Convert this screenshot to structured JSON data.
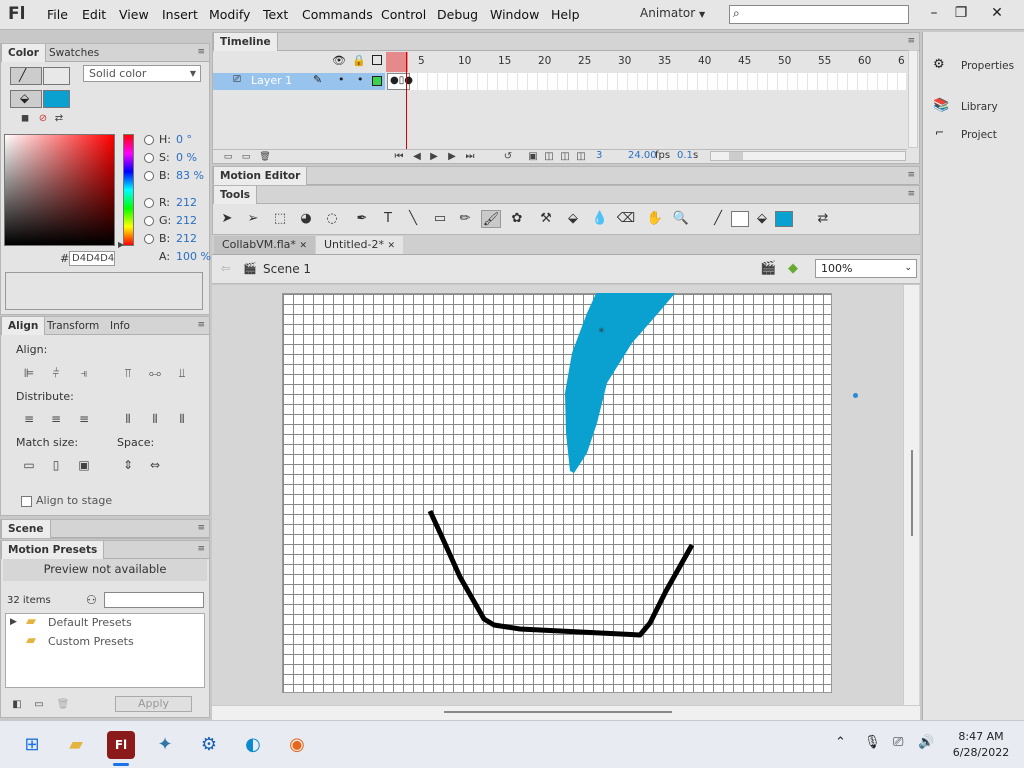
{
  "app": {
    "logo": "Fl",
    "menus": [
      "File",
      "Edit",
      "View",
      "Insert",
      "Modify",
      "Text",
      "Commands",
      "Control",
      "Debug",
      "Window",
      "Help"
    ],
    "workspace": "Animator",
    "search_placeholder": ""
  },
  "color_panel": {
    "tabs": [
      "Color",
      "Swatches"
    ],
    "fill_type": "Solid color",
    "fill_color": "#0aa0cf",
    "hsb": {
      "H": "0 °",
      "S": "0 %",
      "B": "83 %"
    },
    "rgb": {
      "R": "212",
      "G": "212",
      "B": "212"
    },
    "alpha": "100 %",
    "hex_label": "#",
    "hex": "D4D4D4"
  },
  "align_panel": {
    "tabs": [
      "Align",
      "Transform",
      "Info"
    ],
    "align_label": "Align:",
    "distribute_label": "Distribute:",
    "match_label": "Match size:",
    "space_label": "Space:",
    "align_to_stage": "Align to stage"
  },
  "scene_panel": {
    "title": "Scene"
  },
  "motion_presets": {
    "title": "Motion Presets",
    "preview": "Preview not available",
    "count": "32 items",
    "folders": [
      "Default Presets",
      "Custom Presets"
    ],
    "apply": "Apply"
  },
  "timeline": {
    "title": "Timeline",
    "layer": "Layer 1",
    "frame_numbers": [
      "5",
      "10",
      "15",
      "20",
      "25",
      "30",
      "35",
      "40",
      "45",
      "50",
      "55",
      "60",
      "6"
    ],
    "current_frame": "3",
    "fps": "24.00",
    "fps_unit": "fps",
    "time": "0.1",
    "time_unit": "s"
  },
  "motion_editor": {
    "title": "Motion Editor"
  },
  "tools": {
    "title": "Tools",
    "stroke_color": "#ffffff",
    "fill_color": "#0aa0cf"
  },
  "documents": {
    "tabs": [
      "CollabVM.fla*",
      "Untitled-2*"
    ],
    "scene": "Scene 1",
    "zoom": "100%"
  },
  "right_panel": {
    "items": [
      "Properties",
      "Library",
      "Project"
    ]
  },
  "taskbar": {
    "time": "8:47 AM",
    "date": "6/28/2022"
  },
  "colors": {
    "accent": "#0aa0cf",
    "layer_highlight": "#97c3ec",
    "playhead": "#d40000"
  }
}
